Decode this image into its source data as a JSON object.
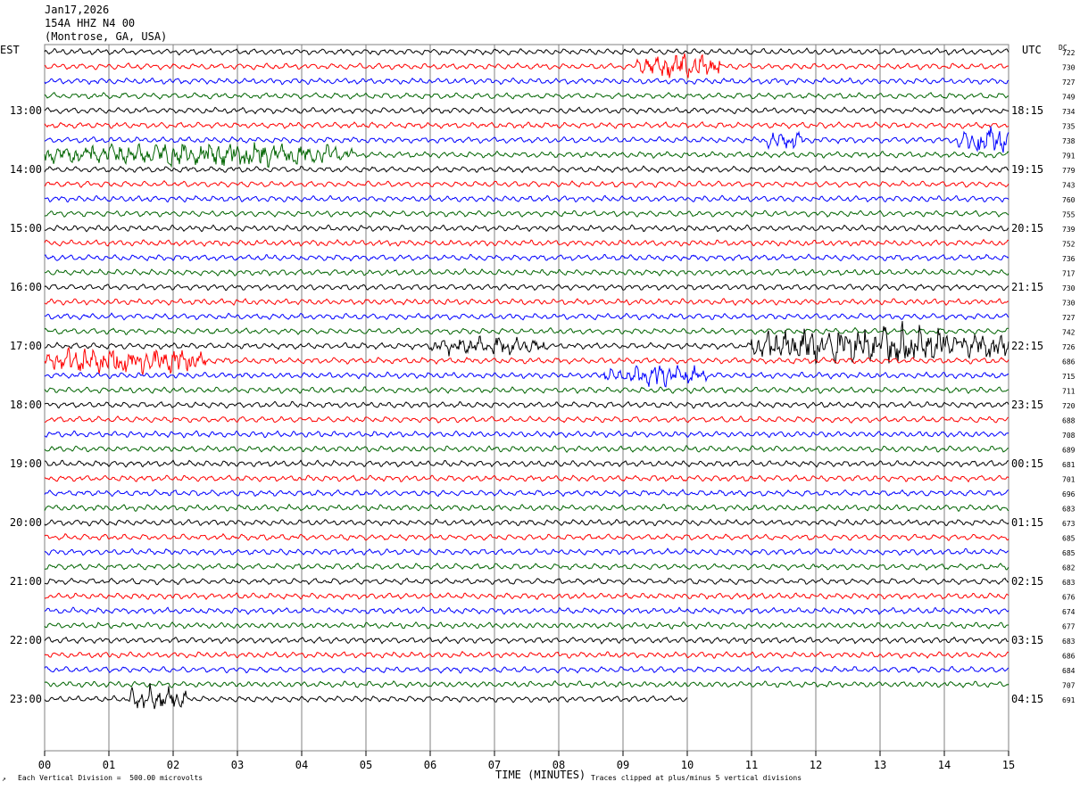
{
  "header": {
    "date": "Jan17,2026",
    "station": "154A HHZ N4 00",
    "location": "(Montrose, GA, USA)"
  },
  "left_zone": "EST",
  "right_zone": "UTC",
  "dc_label": "DC",
  "footer": {
    "scale": "Each Vertical Division =  500.00 microvolts",
    "xlabel": "TIME (MINUTES)",
    "clip": "Traces clipped at plus/minus 5 vertical divisions",
    "corner": "↗"
  },
  "colors": {
    "traces": [
      "#000000",
      "#ff0000",
      "#0000ff",
      "#006400"
    ],
    "grid": "#808080"
  },
  "chart_data": {
    "type": "line",
    "title": "154A HHZ N4 00",
    "xlabel": "TIME (MINUTES)",
    "xlim": [
      0,
      15
    ],
    "x_ticks": [
      "00",
      "01",
      "02",
      "03",
      "04",
      "05",
      "06",
      "07",
      "08",
      "09",
      "10",
      "11",
      "12",
      "13",
      "14",
      "15"
    ],
    "left_hour_labels": [
      "13:00",
      "14:00",
      "15:00",
      "16:00",
      "17:00",
      "18:00",
      "19:00",
      "20:00",
      "21:00",
      "22:00",
      "23:00"
    ],
    "right_hour_labels": [
      "18:15",
      "19:15",
      "20:15",
      "21:15",
      "22:15",
      "23:15",
      "00:15",
      "01:15",
      "02:15",
      "03:15",
      "04:15"
    ],
    "dc_values": [
      722,
      730,
      727,
      749,
      734,
      735,
      738,
      791,
      779,
      743,
      760,
      755,
      739,
      752,
      736,
      717,
      730,
      730,
      727,
      742,
      726,
      686,
      715,
      711,
      720,
      688,
      708,
      689,
      681,
      701,
      696,
      683,
      673,
      685,
      685,
      682,
      683,
      676,
      674,
      677,
      683,
      686,
      684,
      707,
      691
    ],
    "trace_minutes_per_line": 15,
    "last_trace_end_minute": 10,
    "events": [
      {
        "trace": 1,
        "start_min": 9.2,
        "end_min": 10.5,
        "amplitude": 2.2
      },
      {
        "trace": 6,
        "start_min": 11.2,
        "end_min": 11.8,
        "amplitude": 1.6
      },
      {
        "trace": 6,
        "start_min": 14.2,
        "end_min": 15.0,
        "amplitude": 2.4
      },
      {
        "trace": 7,
        "start_min": 0.0,
        "end_min": 4.8,
        "amplitude": 1.8
      },
      {
        "trace": 20,
        "start_min": 6.0,
        "end_min": 7.8,
        "amplitude": 1.3
      },
      {
        "trace": 20,
        "start_min": 11.0,
        "end_min": 15.0,
        "amplitude": 3.0
      },
      {
        "trace": 21,
        "start_min": 0.0,
        "end_min": 2.5,
        "amplitude": 2.2
      },
      {
        "trace": 22,
        "start_min": 8.7,
        "end_min": 10.3,
        "amplitude": 1.6
      },
      {
        "trace": 44,
        "start_min": 1.3,
        "end_min": 2.2,
        "amplitude": 2.2
      }
    ]
  }
}
